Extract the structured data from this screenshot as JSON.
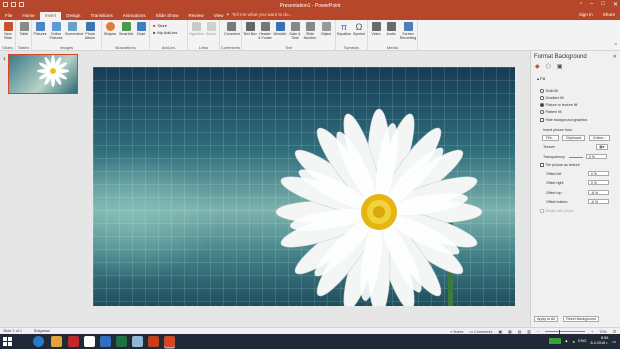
{
  "window": {
    "title": "Presentation1 - PowerPoint"
  },
  "tabs": [
    "File",
    "Home",
    "Insert",
    "Design",
    "Transitions",
    "Animations",
    "Slide Show",
    "Review",
    "View"
  ],
  "active_tab": "Insert",
  "tell_me": "Tell me what you want to do...",
  "account": {
    "sign_in": "Sign in",
    "share": "Share"
  },
  "ribbon_groups": [
    {
      "label": "Slides",
      "buttons": [
        "New Slide"
      ]
    },
    {
      "label": "Tables",
      "buttons": [
        "Table"
      ]
    },
    {
      "label": "Images",
      "buttons": [
        "Pictures",
        "Online Pictures",
        "Screenshot",
        "Photo Album"
      ]
    },
    {
      "label": "Illustrations",
      "buttons": [
        "Shapes",
        "SmartArt",
        "Chart"
      ]
    },
    {
      "label": "Add-ins",
      "buttons": [
        "Store",
        "My Add-ins"
      ]
    },
    {
      "label": "Links",
      "buttons": [
        "Hyperlink",
        "Action"
      ]
    },
    {
      "label": "Comments",
      "buttons": [
        "Comment"
      ]
    },
    {
      "label": "Text",
      "buttons": [
        "Text Box",
        "Header & Footer",
        "WordArt",
        "Date & Time",
        "Slide Number",
        "Object"
      ]
    },
    {
      "label": "Symbols",
      "buttons": [
        "Equation",
        "Symbol"
      ]
    },
    {
      "label": "Media",
      "buttons": [
        "Video",
        "Audio",
        "Screen Recording"
      ]
    }
  ],
  "slides": [
    {
      "number": "1"
    }
  ],
  "format_pane": {
    "title": "Format Background",
    "section": "Fill",
    "fill_options": [
      "Solid fill",
      "Gradient fill",
      "Picture or texture fill",
      "Pattern fill"
    ],
    "selected_fill": "Picture or texture fill",
    "hide_graphics": "Hide background graphics",
    "insert_from": "Insert picture from",
    "buttons": {
      "file": "File...",
      "clipboard": "Clipboard",
      "online": "Online..."
    },
    "texture_label": "Texture",
    "transparency_label": "Transparency",
    "transparency_value": "0 %",
    "tile_label": "Tile picture as texture",
    "offsets": [
      {
        "label": "Offset left",
        "value": "0 %"
      },
      {
        "label": "Offset right",
        "value": "0 %"
      },
      {
        "label": "Offset top",
        "value": "-6 %"
      },
      {
        "label": "Offset bottom",
        "value": "-6 %"
      }
    ],
    "rotate_label": "Rotate with shape",
    "apply_all": "Apply to All",
    "reset": "Reset Background"
  },
  "status": {
    "slide": "Slide 1 of 1",
    "language": "Bulgarian",
    "notes": "Notes",
    "comments": "Comments",
    "zoom": "70%"
  },
  "taskbar": {
    "lang": "ENG",
    "time": "8:56",
    "date": "8.4.2016 r."
  },
  "colors": {
    "accent": "#b7472a",
    "pane": "#f0f0f0"
  }
}
